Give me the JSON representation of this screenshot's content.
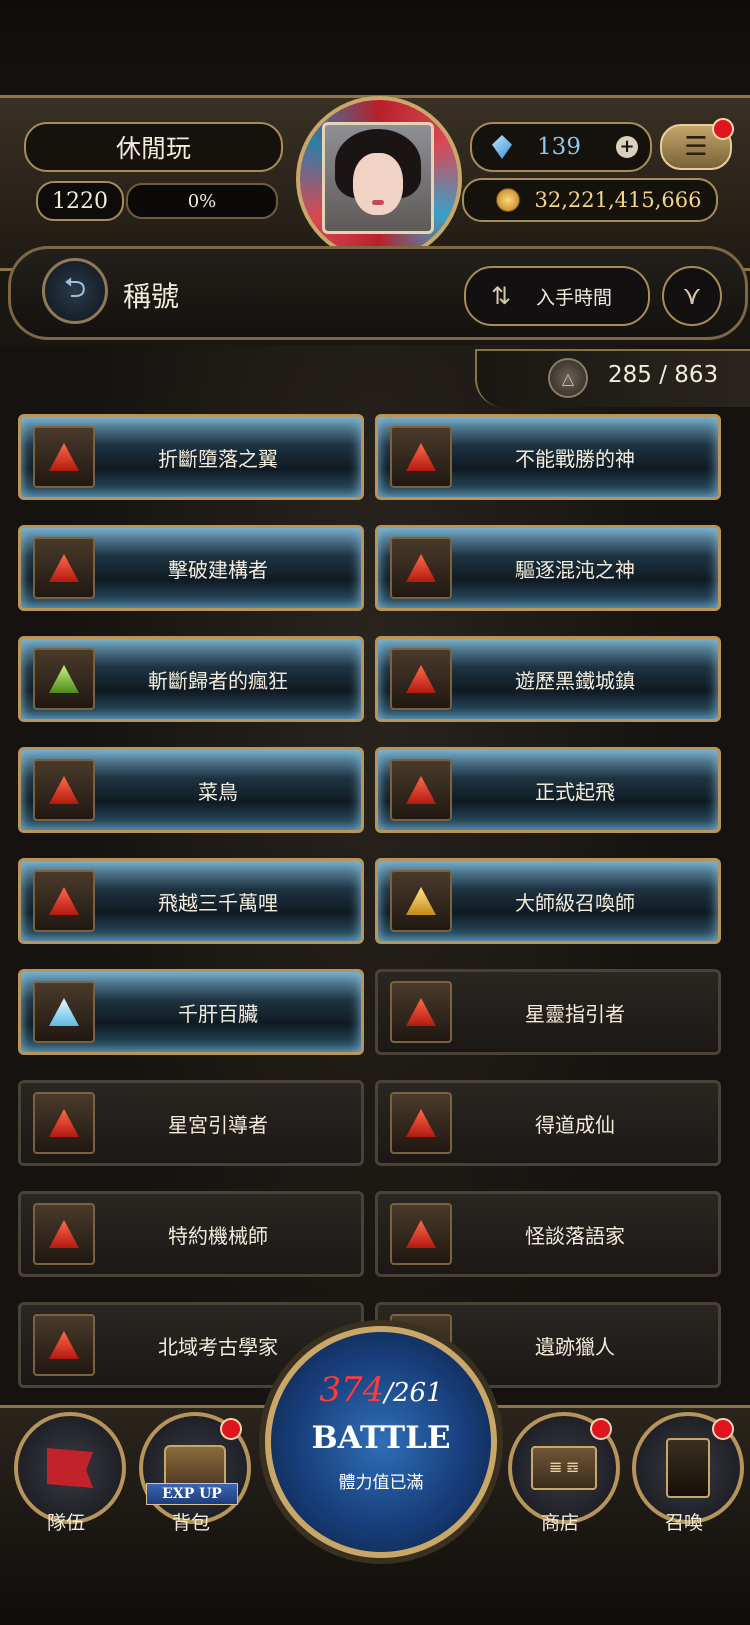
{
  "header": {
    "player_name": "休閒玩",
    "level": "1220",
    "exp_percent": "0%",
    "gems": "139",
    "gems_plus": "+",
    "gold": "32,221,415,666",
    "menu_icon": "☰"
  },
  "title_bar": {
    "title": "稱號",
    "back_icon": "⮌",
    "sort_label": "入手時間",
    "sort_icon": "⇅",
    "filter_icon": "⋎"
  },
  "count": {
    "text": "285 / 863",
    "icon": "△"
  },
  "titles": [
    {
      "label": "折斷墮落之翼",
      "active": true,
      "icon_color": "red"
    },
    {
      "label": "不能戰勝的神",
      "active": true,
      "icon_color": "red"
    },
    {
      "label": "擊破建構者",
      "active": true,
      "icon_color": "red"
    },
    {
      "label": "驅逐混沌之神",
      "active": true,
      "icon_color": "red"
    },
    {
      "label": "斬斷歸者的瘋狂",
      "active": true,
      "icon_color": "green"
    },
    {
      "label": "遊歷黑鐵城鎮",
      "active": true,
      "icon_color": "red"
    },
    {
      "label": "菜鳥",
      "active": true,
      "icon_color": "red"
    },
    {
      "label": "正式起飛",
      "active": true,
      "icon_color": "red"
    },
    {
      "label": "飛越三千萬哩",
      "active": true,
      "icon_color": "red"
    },
    {
      "label": "大師級召喚師",
      "active": true,
      "icon_color": "gold"
    },
    {
      "label": "千肝百臟",
      "active": true,
      "icon_color": "blue"
    },
    {
      "label": "星靈指引者",
      "active": false,
      "icon_color": "red"
    },
    {
      "label": "星宮引導者",
      "active": false,
      "icon_color": "red"
    },
    {
      "label": "得道成仙",
      "active": false,
      "icon_color": "red"
    },
    {
      "label": "特約機械師",
      "active": false,
      "icon_color": "red"
    },
    {
      "label": "怪談落語家",
      "active": false,
      "icon_color": "red"
    },
    {
      "label": "北域考古學家",
      "active": false,
      "icon_color": "red"
    },
    {
      "label": "遺跡獵人",
      "active": false,
      "icon_color": "red"
    }
  ],
  "bottom_nav": {
    "team_label": "隊伍",
    "bag_label": "背包",
    "exp_up": "EXP UP",
    "shop_label": "商店",
    "shop_sign": "𝌆 𝌉",
    "summon_label": "召喚",
    "battle": {
      "stamina_current": "374",
      "stamina_max": "/261",
      "label": "BATTLE",
      "sub_label": "體力值已滿"
    }
  }
}
